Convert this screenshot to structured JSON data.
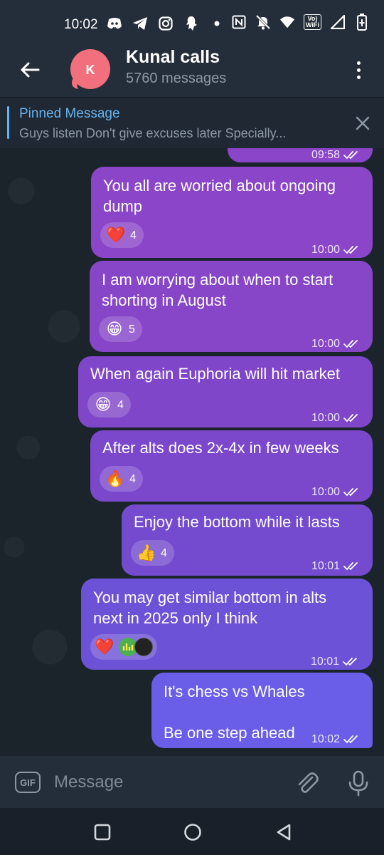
{
  "status_bar": {
    "time": "10:02",
    "left_icons": [
      "discord-icon",
      "telegram-icon",
      "instagram-icon",
      "snapchat-icon",
      "dot-icon"
    ],
    "right_icons": [
      "nfc-icon",
      "mute-icon",
      "wifi-icon",
      "volte-icon",
      "signal-icon",
      "battery-icon"
    ],
    "volte_label": "Vo)\nWiFi"
  },
  "header": {
    "title": "Kunal calls",
    "subtitle": "5760 messages",
    "avatar_letter": "K",
    "avatar_color": "#f2707d"
  },
  "pinned": {
    "title": "Pinned Message",
    "text": "Guys listen   Don't give excuses later  Specially..."
  },
  "messages": [
    {
      "text": "",
      "time": "09:58",
      "reaction_emoji": "❤️",
      "reaction_count": ""
    },
    {
      "text": "You all are worried about ongoing\ndump",
      "time": "10:00",
      "reaction_emoji": "❤️",
      "reaction_count": "4"
    },
    {
      "text": "I am worrying about when to start\nshorting in August",
      "time": "10:00",
      "reaction_emoji": "😁",
      "reaction_count": "5"
    },
    {
      "text": "When again Euphoria will hit market",
      "time": "10:00",
      "reaction_emoji": "😁",
      "reaction_count": "4"
    },
    {
      "text": "After alts does 2x-4x in few weeks",
      "time": "10:00",
      "reaction_emoji": "🔥",
      "reaction_count": "4"
    },
    {
      "text": "Enjoy the bottom while it lasts",
      "time": "10:01",
      "reaction_emoji": "👍",
      "reaction_count": "4"
    },
    {
      "text": "You may get similar bottom in alts\nnext in 2025 only I think",
      "time": "10:01",
      "reaction_emoji": "❤️",
      "reaction_count": ""
    },
    {
      "text": "It's chess vs Whales\n\nBe one step ahead",
      "time": "10:02",
      "reaction_emoji": "",
      "reaction_count": ""
    }
  ],
  "input": {
    "gif_label": "GIF",
    "placeholder": "Message"
  },
  "colors": {
    "bubble_purple": "#8a45c9",
    "bubble_blue": "#6a5ee8",
    "header_bg": "#242e3a",
    "accent": "#66b2ee"
  }
}
